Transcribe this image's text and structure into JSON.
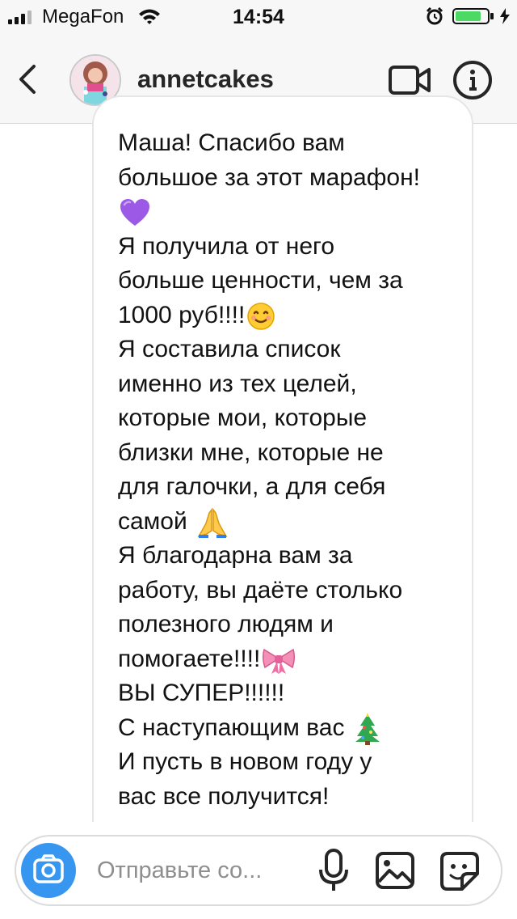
{
  "status_bar": {
    "carrier": "MegaFon",
    "time": "14:54",
    "battery_color": "#4cd964",
    "icons": [
      "signal-icon",
      "wifi-icon",
      "alarm-icon",
      "battery-icon",
      "charging-icon"
    ]
  },
  "header": {
    "username": "annetcakes",
    "icons": [
      "back-icon",
      "avatar",
      "video-call-icon",
      "info-icon"
    ]
  },
  "message": {
    "lines": [
      "Маша! Спасибо вам",
      "большое за этот марафон!",
      "",
      "Я получила от него",
      "больше ценности, чем за",
      "1000 руб!!!!",
      "Я составила список",
      "именно из тех целей,",
      "которые мои, которые",
      "близки мне, которые не",
      "для галочки, а для себя",
      "самой ",
      "Я благодарна вам за",
      "работу, вы даёте столько",
      "полезного людям и",
      "помогаете!!!!",
      "ВЫ СУПЕР!!!!!!",
      "С наступающим вас ",
      "И пусть в новом году у",
      "вас все получится!"
    ],
    "emojis": [
      "purple-heart-emoji",
      "smiling-face-emoji",
      "folded-hands-emoji",
      "ribbon-emoji",
      "christmas-tree-emoji"
    ]
  },
  "composer": {
    "placeholder": "Отправьте со...",
    "accent_color": "#3797f0",
    "icons": [
      "camera-icon",
      "microphone-icon",
      "gallery-icon",
      "sticker-icon"
    ]
  }
}
